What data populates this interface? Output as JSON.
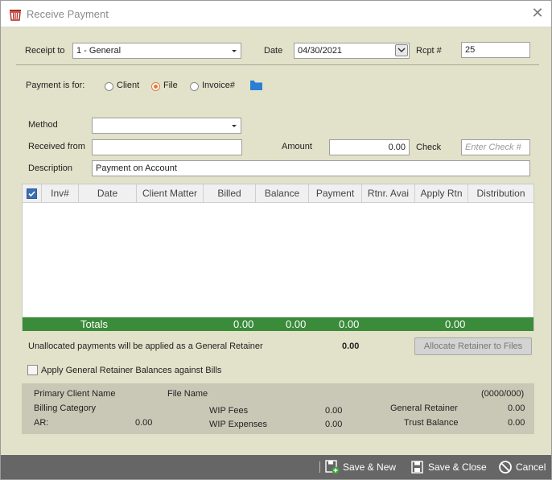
{
  "window": {
    "title": "Receive Payment"
  },
  "header": {
    "receipt_to_label": "Receipt to",
    "receipt_to_value": "1 - General",
    "date_label": "Date",
    "date_value": "04/30/2021",
    "rcpt_label": "Rcpt #",
    "rcpt_value": "25"
  },
  "payment_for": {
    "label": "Payment is for:",
    "options": [
      "Client",
      "File",
      "Invoice#"
    ],
    "selected": "File"
  },
  "form": {
    "method_label": "Method",
    "method_value": "",
    "received_from_label": "Received from",
    "received_from_value": "",
    "amount_label": "Amount",
    "amount_value": "0.00",
    "check_label": "Check",
    "check_placeholder": "Enter Check #",
    "description_label": "Description",
    "description_value": "Payment on Account"
  },
  "grid": {
    "columns": [
      "Inv#",
      "Date",
      "Client Matter",
      "Billed",
      "Balance",
      "Payment",
      "Rtnr. Avai",
      "Apply Rtn",
      "Distribution"
    ],
    "rows": [],
    "totals": {
      "label": "Totals",
      "billed": "0.00",
      "balance": "0.00",
      "payment": "0.00",
      "apply_rtn": "0.00"
    }
  },
  "retainer": {
    "unallocated_text": "Unallocated payments will be applied as a General Retainer",
    "unallocated_value": "0.00",
    "allocate_button": "Allocate Retainer to Files",
    "apply_checkbox_label": "Apply General Retainer Balances against Bills",
    "apply_checked": false
  },
  "info": {
    "primary_client_label": "Primary Client Name",
    "file_name_label": "File Name",
    "code": "(0000/000)",
    "billing_category_label": "Billing Category",
    "general_retainer_label": "General Retainer",
    "general_retainer_value": "0.00",
    "wip_fees_label": "WIP Fees",
    "wip_fees_value": "0.00",
    "ar_label": "AR:",
    "ar_value": "0.00",
    "wip_expenses_label": "WIP Expenses",
    "wip_expenses_value": "0.00",
    "trust_balance_label": "Trust Balance",
    "trust_balance_value": "0.00"
  },
  "footer": {
    "save_new": "Save & New",
    "save_close": "Save & Close",
    "cancel": "Cancel"
  },
  "colors": {
    "background": "#e2e1c9",
    "grid_totals": "#3a8b3a",
    "radio_selected": "#e07b39",
    "footer": "#666666",
    "folder_icon": "#2a7fd4"
  },
  "icons": [
    "app-logo-icon",
    "close-icon",
    "dropdown-arrow-icon",
    "calendar-dropdown-icon",
    "folder-icon",
    "select-all-check-icon",
    "save-new-icon",
    "save-close-icon",
    "cancel-icon"
  ]
}
